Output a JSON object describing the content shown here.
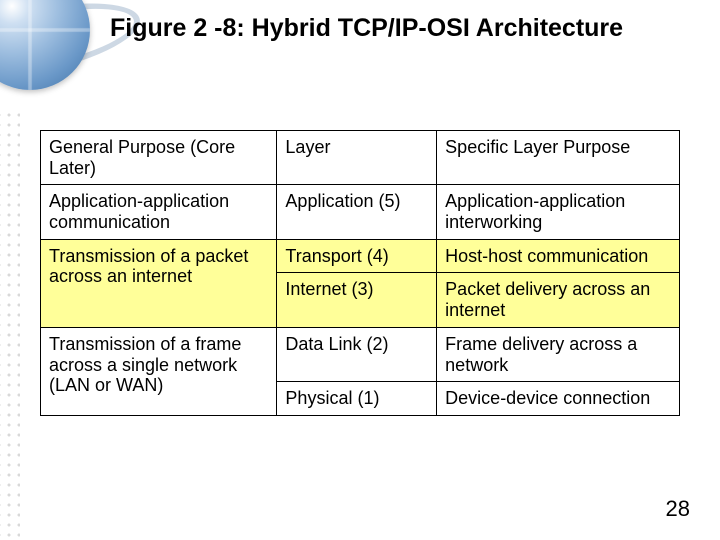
{
  "title": "Figure 2 -8: Hybrid TCP/IP-OSI Architecture",
  "page_number": "28",
  "table": {
    "h1": "General Purpose (Core Later)",
    "h2": "Layer",
    "h3": "Specific Layer Purpose",
    "r1c1": "Application-application communication",
    "r1c2": "Application (5)",
    "r1c3": "Application-application interworking",
    "r2c1": "Transmission of a packet across an internet",
    "r2c2": "Transport (4)",
    "r2c3": "Host-host communication",
    "r3c2": "Internet (3)",
    "r3c3": "Packet delivery across an internet",
    "r4c1": "Transmission of a frame across a single network (LAN or WAN)",
    "r4c2": "Data Link (2)",
    "r4c3": "Frame delivery across a network",
    "r5c2": "Physical (1)",
    "r5c3": "Device-device connection"
  }
}
